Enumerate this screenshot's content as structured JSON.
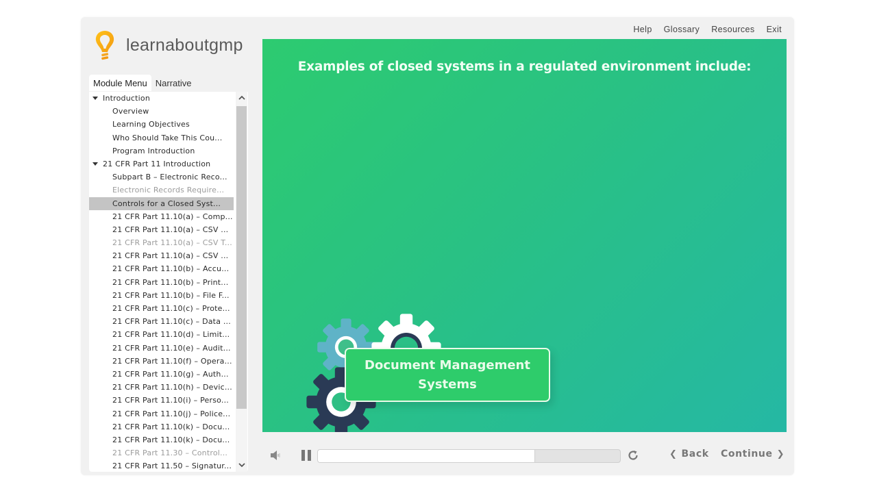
{
  "app": {
    "logo_text": "learnaboutgmp",
    "logo_icon": "lightbulb-icon",
    "accent_color": "#f5a623"
  },
  "top_links": [
    {
      "label": "Help"
    },
    {
      "label": "Glossary"
    },
    {
      "label": "Resources"
    },
    {
      "label": "Exit"
    }
  ],
  "sidebar": {
    "tabs": [
      {
        "label": "Module Menu",
        "active": true
      },
      {
        "label": "Narrative",
        "active": false
      }
    ],
    "items": [
      {
        "label": "Introduction",
        "type": "section",
        "state": "normal"
      },
      {
        "label": "Overview",
        "type": "child",
        "state": "normal"
      },
      {
        "label": "Learning Objectives",
        "type": "child",
        "state": "normal"
      },
      {
        "label": "Who Should Take This Cou...",
        "type": "child",
        "state": "normal"
      },
      {
        "label": "Program Introduction",
        "type": "child",
        "state": "normal"
      },
      {
        "label": "21 CFR Part 11 Introduction",
        "type": "section",
        "state": "normal"
      },
      {
        "label": "Subpart B – Electronic Reco...",
        "type": "child",
        "state": "normal"
      },
      {
        "label": "Electronic Records Require...",
        "type": "child",
        "state": "visited"
      },
      {
        "label": "Controls for a Closed Syst...",
        "type": "child",
        "state": "selected"
      },
      {
        "label": "21 CFR Part 11.10(a) – Comp...",
        "type": "child",
        "state": "normal"
      },
      {
        "label": "21 CFR Part 11.10(a) – CSV ...",
        "type": "child",
        "state": "normal"
      },
      {
        "label": "21 CFR Part 11.10(a) – CSV T...",
        "type": "child",
        "state": "visited"
      },
      {
        "label": "21 CFR Part 11.10(a) – CSV ...",
        "type": "child",
        "state": "normal"
      },
      {
        "label": "21 CFR Part 11.10(b) – Accu...",
        "type": "child",
        "state": "normal"
      },
      {
        "label": "21 CFR Part 11.10(b) – Print...",
        "type": "child",
        "state": "normal"
      },
      {
        "label": "21 CFR Part 11.10(b) – File F...",
        "type": "child",
        "state": "normal"
      },
      {
        "label": "21 CFR Part 11.10(c) – Prote...",
        "type": "child",
        "state": "normal"
      },
      {
        "label": "21 CFR Part 11.10(c) – Data ...",
        "type": "child",
        "state": "normal"
      },
      {
        "label": "21 CFR Part 11.10(d) – Limit...",
        "type": "child",
        "state": "normal"
      },
      {
        "label": "21 CFR Part 11.10(e) – Audit...",
        "type": "child",
        "state": "normal"
      },
      {
        "label": "21 CFR Part 11.10(f) – Opera...",
        "type": "child",
        "state": "normal"
      },
      {
        "label": "21 CFR Part 11.10(g) – Auth...",
        "type": "child",
        "state": "normal"
      },
      {
        "label": "21 CFR Part 11.10(h) – Devic...",
        "type": "child",
        "state": "normal"
      },
      {
        "label": "21 CFR Part 11.10(i) – Perso...",
        "type": "child",
        "state": "normal"
      },
      {
        "label": "21 CFR Part 11.10(j) – Police...",
        "type": "child",
        "state": "normal"
      },
      {
        "label": "21 CFR Part 11.10(k) – Docu...",
        "type": "child",
        "state": "normal"
      },
      {
        "label": "21 CFR Part 11.10(k) – Docu...",
        "type": "child",
        "state": "normal"
      },
      {
        "label": "21 CFR Part 11.30 – Control...",
        "type": "child",
        "state": "visited"
      },
      {
        "label": "21 CFR Part 11.50 – Signatur...",
        "type": "child",
        "state": "normal"
      }
    ],
    "scroll_up_icon": "chevron-up-icon",
    "scroll_down_icon": "chevron-down-icon"
  },
  "slide": {
    "title": "Examples of closed systems in a regulated environment include:",
    "callout": "Document Management Systems",
    "gear_colors": {
      "blue": "#5fb3c7",
      "white": "#ffffff",
      "navy": "#2a3a55"
    }
  },
  "controls": {
    "volume_icon": "speaker-icon",
    "pause_icon": "pause-icon",
    "replay_icon": "replay-icon",
    "progress_percent": 71.7,
    "back_label": "Back",
    "continue_label": "Continue"
  }
}
